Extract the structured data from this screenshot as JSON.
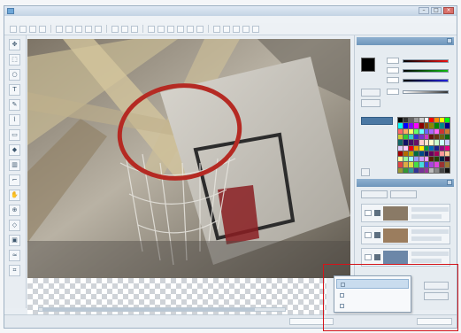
{
  "window": {
    "title": "",
    "minimize_glyph": "–",
    "maximize_glyph": "□",
    "close_glyph": "×"
  },
  "menu": {
    "items": [
      "",
      "",
      "",
      "",
      "",
      "",
      "",
      ""
    ]
  },
  "left_tools": [
    {
      "icon": "move-icon",
      "glyph": "✥"
    },
    {
      "icon": "select-icon",
      "glyph": "⬚"
    },
    {
      "icon": "lasso-icon",
      "glyph": "○"
    },
    {
      "icon": "text-icon",
      "glyph": "T"
    },
    {
      "icon": "pencil-icon",
      "glyph": "✎"
    },
    {
      "icon": "brush-icon",
      "glyph": "⌇"
    },
    {
      "icon": "eraser-icon",
      "glyph": "▭"
    },
    {
      "icon": "fill-icon",
      "glyph": "◆"
    },
    {
      "icon": "gradient-icon",
      "glyph": "▥"
    },
    {
      "icon": "eyedropper-icon",
      "glyph": "⌐"
    },
    {
      "icon": "hand-icon",
      "glyph": "✋"
    },
    {
      "icon": "zoom-icon",
      "glyph": "⊕"
    },
    {
      "icon": "shape-icon",
      "glyph": "◇"
    },
    {
      "icon": "stamp-icon",
      "glyph": "▣"
    },
    {
      "icon": "blur-icon",
      "glyph": "≈"
    },
    {
      "icon": "crop-icon",
      "glyph": "⌗"
    }
  ],
  "colors": {
    "accent": "#6e95bb",
    "highlight_box": "#d4141a",
    "foreground_color": "#000000"
  },
  "color_panel": {
    "title": ""
  },
  "layer_panel": {
    "title": ""
  },
  "palette": [
    "#000000",
    "#333333",
    "#666666",
    "#999999",
    "#cccccc",
    "#ffffff",
    "#ff0000",
    "#ff8800",
    "#ffff00",
    "#00ff00",
    "#00ffff",
    "#0000ff",
    "#8800ff",
    "#ff00ff",
    "#880000",
    "#884400",
    "#888800",
    "#008800",
    "#008888",
    "#000088",
    "#ff6666",
    "#ffaa66",
    "#ffff66",
    "#66ff66",
    "#66ffff",
    "#6666ff",
    "#aa66ff",
    "#ff66ff",
    "#cc3333",
    "#cc7733",
    "#cccc33",
    "#33cc33",
    "#33cccc",
    "#3333cc",
    "#7733cc",
    "#cc33cc",
    "#661111",
    "#663311",
    "#666611",
    "#116611",
    "#116666",
    "#111166",
    "#441166",
    "#661166",
    "#ffcccc",
    "#ffe0cc",
    "#ffffcc",
    "#ccffcc",
    "#ccffff",
    "#ccccff",
    "#e0ccff",
    "#ffccff",
    "#e60012",
    "#f39800",
    "#fff100",
    "#009944",
    "#0068b7",
    "#1d2088",
    "#920783",
    "#e4007f",
    "#a40000",
    "#b36b00",
    "#b7aa00",
    "#006b3f",
    "#004986",
    "#12155f",
    "#68005b",
    "#a4005b",
    "#ff9999",
    "#ffcc99",
    "#ffff99",
    "#99ff99",
    "#99ffff",
    "#9999ff",
    "#cc99ff",
    "#ff99ff",
    "#552200",
    "#224400",
    "#002244",
    "#440022",
    "#dd4444",
    "#ddaa44",
    "#dddd44",
    "#44dd44",
    "#44dddd",
    "#4444dd",
    "#aa44dd",
    "#dd44dd",
    "#993333",
    "#997733",
    "#999933",
    "#339933",
    "#339999",
    "#333399",
    "#773399",
    "#993399",
    "#bbbbbb",
    "#888888",
    "#444444",
    "#111111"
  ],
  "layers": [
    {
      "thumb": "#8a7a66"
    },
    {
      "thumb": "#9b7d5e"
    },
    {
      "thumb": "#6c87a8"
    }
  ],
  "context_menu": {
    "items": [
      {
        "label": "",
        "highlighted": true
      },
      {
        "label": "",
        "highlighted": false
      },
      {
        "label": "",
        "highlighted": false
      }
    ]
  }
}
